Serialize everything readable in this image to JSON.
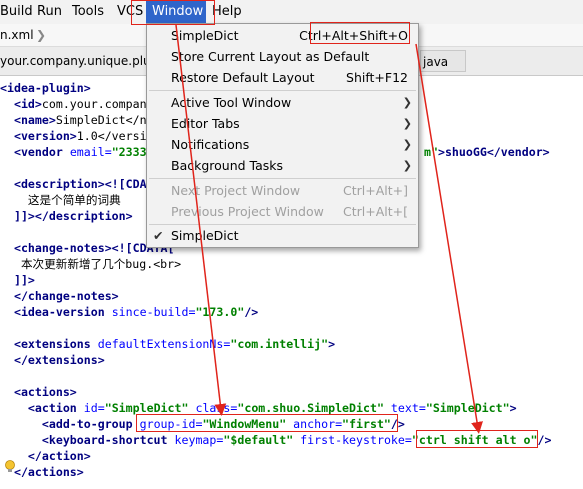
{
  "menubar": {
    "items": [
      "Build",
      "Run",
      "Tools",
      "VCS",
      "Window",
      "Help"
    ],
    "active": "Window"
  },
  "breadcrumb": {
    "file": "n.xml"
  },
  "tabs": {
    "left": "your.company.unique.plug",
    "right": "java"
  },
  "window_menu": {
    "items": [
      {
        "label": "SimpleDict",
        "shortcut": "Ctrl+Alt+Shift+O"
      },
      {
        "label": "Store Current Layout as Default",
        "shortcut": ""
      },
      {
        "label": "Restore Default Layout",
        "shortcut": "Shift+F12"
      },
      {
        "label": "Active Tool Window",
        "shortcut": ""
      },
      {
        "label": "Editor Tabs",
        "shortcut": ""
      },
      {
        "label": "Notifications",
        "shortcut": ""
      },
      {
        "label": "Background Tasks",
        "shortcut": ""
      },
      {
        "label": "Next Project Window",
        "shortcut": "Ctrl+Alt+]"
      },
      {
        "label": "Previous Project Window",
        "shortcut": "Ctrl+Alt+["
      },
      {
        "label": "SimpleDict",
        "shortcut": ""
      }
    ]
  },
  "editor": {
    "l1": "<idea-plugin>",
    "l2_tag": "  <id>",
    "l2_txt": "com.your.compan",
    "l3_tag": "  <name>",
    "l3_txt": "SimpleDict</n",
    "l4_tag": "  <version>",
    "l4_txt": "1.0</versi",
    "l5_tag": "  <vendor ",
    "l5_attr": "email=",
    "l5_val": "\"2333",
    "l5_tail_val": "m\"",
    "l5_tail": ">shuoGG</vendor>",
    "l7": "  <description><![CDA",
    "l8": "    这是个简单的词典",
    "l9": "  ]]></description>",
    "l11": "  <change-notes><![CDATA[",
    "l12": "   本次更新新增了几个bug.<br>",
    "l13": "  ]]>",
    "l14": "  </change-notes>",
    "l15_tag": "  <idea-version ",
    "l15_attr": "since-build=",
    "l15_val": "\"173.0\"",
    "l15_end": "/>",
    "l17_tag": "  <extensions ",
    "l17_attr": "defaultExtensionNs=",
    "l17_val": "\"com.intellij\"",
    "l17_end": ">",
    "l18": "  </extensions>",
    "l20": "  <actions>",
    "l21_tag": "    <action ",
    "l21_a1": "id=",
    "l21_v1": "\"SimpleDict\"",
    "l21_a2": " class=",
    "l21_v2": "\"com.shuo.SimpleDict\"",
    "l21_a3": " text=",
    "l21_v3": "\"SimpleDict\"",
    "l21_end": ">",
    "l22_tag": "      <add-to-group ",
    "l22_a1": "group-id=",
    "l22_v1": "\"WindowMenu\"",
    "l22_a2": " anchor=",
    "l22_v2": "\"first\"",
    "l22_end": "/>",
    "l23_tag": "      <keyboard-shortcut ",
    "l23_a1": "keymap=",
    "l23_v1": "\"$default\"",
    "l23_a2": " first-keystroke=",
    "l23_v2": "\"ctrl shift alt o\"",
    "l23_end": "/>",
    "l24": "    </action>",
    "l25": "  </actions>"
  }
}
